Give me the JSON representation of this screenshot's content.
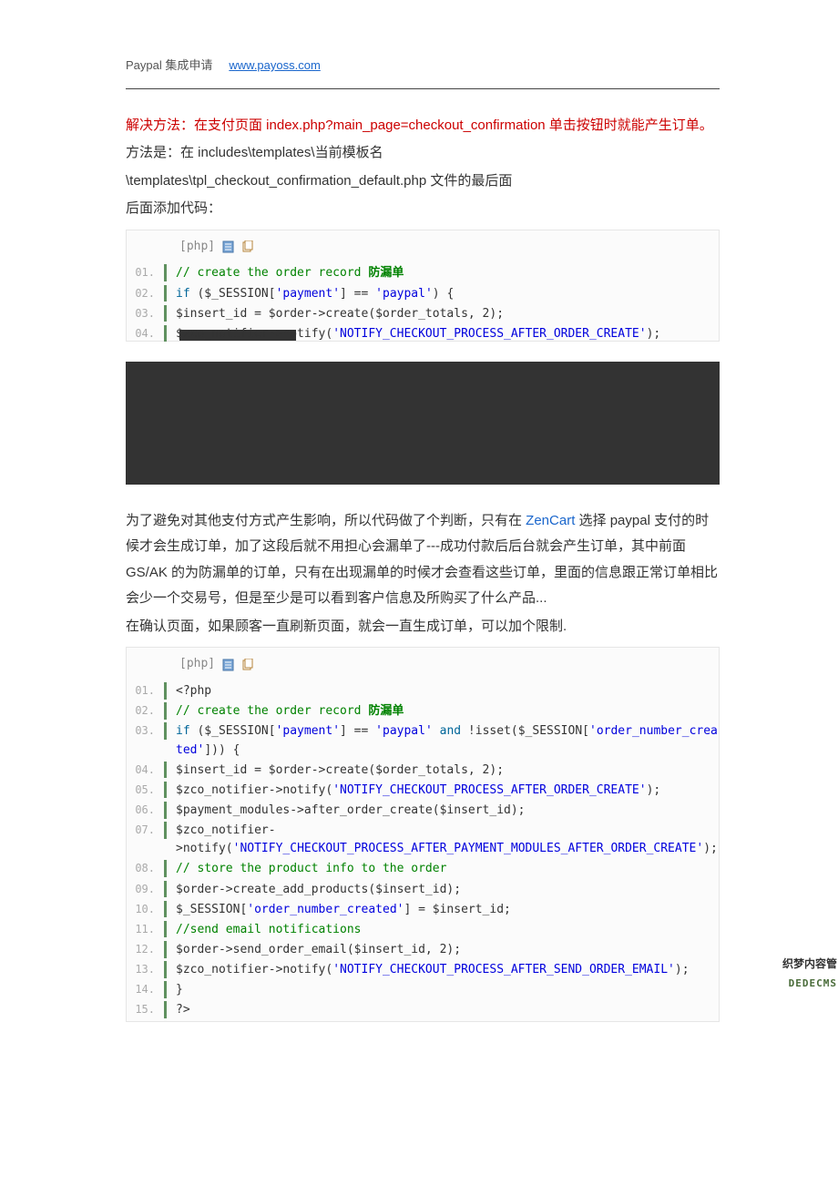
{
  "header": {
    "title": "Paypal 集成申请",
    "link": "www.payoss.com"
  },
  "section1": {
    "solution_prefix": "解决方法：在支付页面 ",
    "solution_code": "index.php?main_page=checkout_confirmation",
    "solution_suffix": " 单击按钮时就能产生订单。",
    "method_line": "方法是：在 includes\\templates\\当前模板名",
    "path_line": "\\templates\\tpl_checkout_confirmation_default.php 文件的最后面",
    "append_line": "后面添加代码："
  },
  "code1": {
    "lang": "[php]",
    "icons": {
      "view": "view-icon",
      "copy": "copy-icon"
    },
    "lines": [
      {
        "n": "01.",
        "type": "comment",
        "text": "// create the order record 防漏单",
        "extra_comment": "防漏单"
      },
      {
        "n": "02.",
        "text": "if ($_SESSION['payment'] == 'paypal') {"
      },
      {
        "n": "03.",
        "text": "$insert_id = $order->create($order_totals, 2);"
      },
      {
        "n": "04.",
        "text": "$zco_notifier->notify('NOTIFY_CHECKOUT_PROCESS_AFTER_ORDER_CREATE');"
      }
    ]
  },
  "section2": {
    "para1_a": "为了避免对其他支付方式产生影响，所以代码做了个判断，只有在 ",
    "para1_link": "ZenCart",
    "para1_b": " 选择 paypal 支付的时候才会生成订单，加了这段后就不用担心会漏单了---成功付款后后台就会产生订单，其中前面 GS/AK 的为防漏单的订单，只有在出现漏单的时候才会查看这些订单，里面的信息跟正常订单相比会少一个交易号，但是至少是可以看到客户信息及所购买了什么产品...",
    "para2": "在确认页面，如果顾客一直刷新页面，就会一直生成订单，可以加个限制."
  },
  "code2": {
    "lang": "[php]",
    "lines": [
      {
        "n": "01.",
        "text": "<?php"
      },
      {
        "n": "02.",
        "text": "// create the order record 防漏单"
      },
      {
        "n": "03.",
        "text": "if ($_SESSION['payment'] == 'paypal' and !isset($_SESSION['order_number_created'])) {"
      },
      {
        "n": "04.",
        "text": "$insert_id = $order->create($order_totals, 2);"
      },
      {
        "n": "05.",
        "text": "$zco_notifier->notify('NOTIFY_CHECKOUT_PROCESS_AFTER_ORDER_CREATE');"
      },
      {
        "n": "06.",
        "text": "$payment_modules->after_order_create($insert_id);"
      },
      {
        "n": "07.",
        "text": "$zco_notifier->notify('NOTIFY_CHECKOUT_PROCESS_AFTER_PAYMENT_MODULES_AFTER_ORDER_CREATE');"
      },
      {
        "n": "08.",
        "text": "// store the product info to the order"
      },
      {
        "n": "09.",
        "text": "$order->create_add_products($insert_id);"
      },
      {
        "n": "10.",
        "text": "$_SESSION['order_number_created'] = $insert_id;"
      },
      {
        "n": "11.",
        "text": "//send email notifications"
      },
      {
        "n": "12.",
        "text": "$order->send_order_email($insert_id, 2);"
      },
      {
        "n": "13.",
        "text": "$zco_notifier->notify('NOTIFY_CHECKOUT_PROCESS_AFTER_SEND_ORDER_EMAIL');"
      },
      {
        "n": "14.",
        "text": "}"
      },
      {
        "n": "15.",
        "text": "?>"
      }
    ]
  },
  "watermark": {
    "line1": "织梦内容管",
    "line2": "DEDECMS"
  }
}
